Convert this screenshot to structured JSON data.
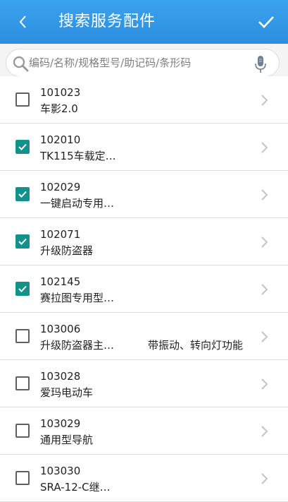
{
  "header": {
    "title": "搜索服务配件",
    "back_icon": "chevron-left-icon",
    "confirm_icon": "check-icon"
  },
  "search": {
    "placeholder": "编码/名称/规格型号/助记码/条形码",
    "value": "",
    "icon": "search-icon",
    "voice_icon": "microphone-icon"
  },
  "items": [
    {
      "code": "101023",
      "name": "车影2.0",
      "extra": "",
      "checked": false
    },
    {
      "code": "102010",
      "name": "TK115车载定…",
      "extra": "",
      "checked": true
    },
    {
      "code": "102029",
      "name": "一键启动专用…",
      "extra": "",
      "checked": true
    },
    {
      "code": "102071",
      "name": "升级防盗器",
      "extra": "",
      "checked": true
    },
    {
      "code": "102145",
      "name": "赛拉图专用型…",
      "extra": "",
      "checked": true
    },
    {
      "code": "103006",
      "name": "升级防盗器主…",
      "extra": "带振动、转向灯功能",
      "checked": false
    },
    {
      "code": "103028",
      "name": "爱玛电动车",
      "extra": "",
      "checked": false
    },
    {
      "code": "103029",
      "name": "通用型导航",
      "extra": "",
      "checked": false
    },
    {
      "code": "103030",
      "name": "SRA-12-C继…",
      "extra": "",
      "checked": false
    }
  ],
  "colors": {
    "header": "#2c8ee0",
    "checked": "#13918a"
  }
}
